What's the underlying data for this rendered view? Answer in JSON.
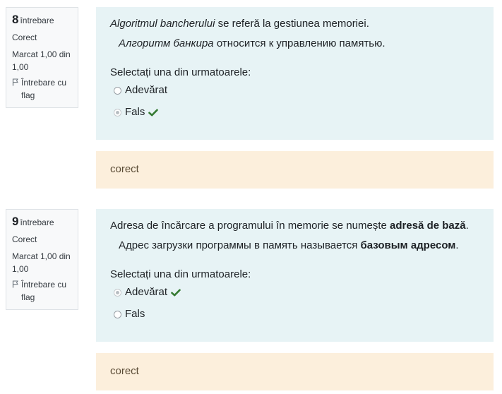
{
  "questions": [
    {
      "number": "8",
      "label": "întrebare",
      "state": "Corect",
      "mark": "Marcat 1,00 din 1,00",
      "flag_label": "Întrebare cu flag",
      "text_ro_em": "Algoritmul bancherului",
      "text_ro_rest": " se referă la gestiunea memoriei.",
      "text_ru_em": "Алгоритм банкира",
      "text_ru_rest": " относится к управлению памятью.",
      "prompt": "Selectați una din urmatoarele:",
      "options": [
        {
          "label": "Adevărat",
          "checked": false,
          "correct_mark": false
        },
        {
          "label": "Fals",
          "checked": true,
          "correct_mark": true
        }
      ],
      "feedback": "corect"
    },
    {
      "number": "9",
      "label": "întrebare",
      "state": "Corect",
      "mark": "Marcat 1,00 din 1,00",
      "flag_label": "Întrebare cu flag",
      "text_ro_pre": "Adresa de încărcare a programului în memorie se numește ",
      "text_ro_bold": "adresă de bază",
      "text_ro_post": ".",
      "text_ru_pre": "Адрес загрузки программы в память называется ",
      "text_ru_bold": "базовым адресом",
      "text_ru_post": ".",
      "prompt": "Selectați una din urmatoarele:",
      "options": [
        {
          "label": "Adevărat",
          "checked": true,
          "correct_mark": true
        },
        {
          "label": "Fals",
          "checked": false,
          "correct_mark": false
        }
      ],
      "feedback": "corect"
    }
  ],
  "colors": {
    "formulation_bg": "#e7f3f5",
    "feedback_bg": "#fcefdc",
    "correct_check": "#357a32"
  },
  "icons": {
    "flag": "flag-icon",
    "correct": "check-icon",
    "radio": "radio-button"
  }
}
